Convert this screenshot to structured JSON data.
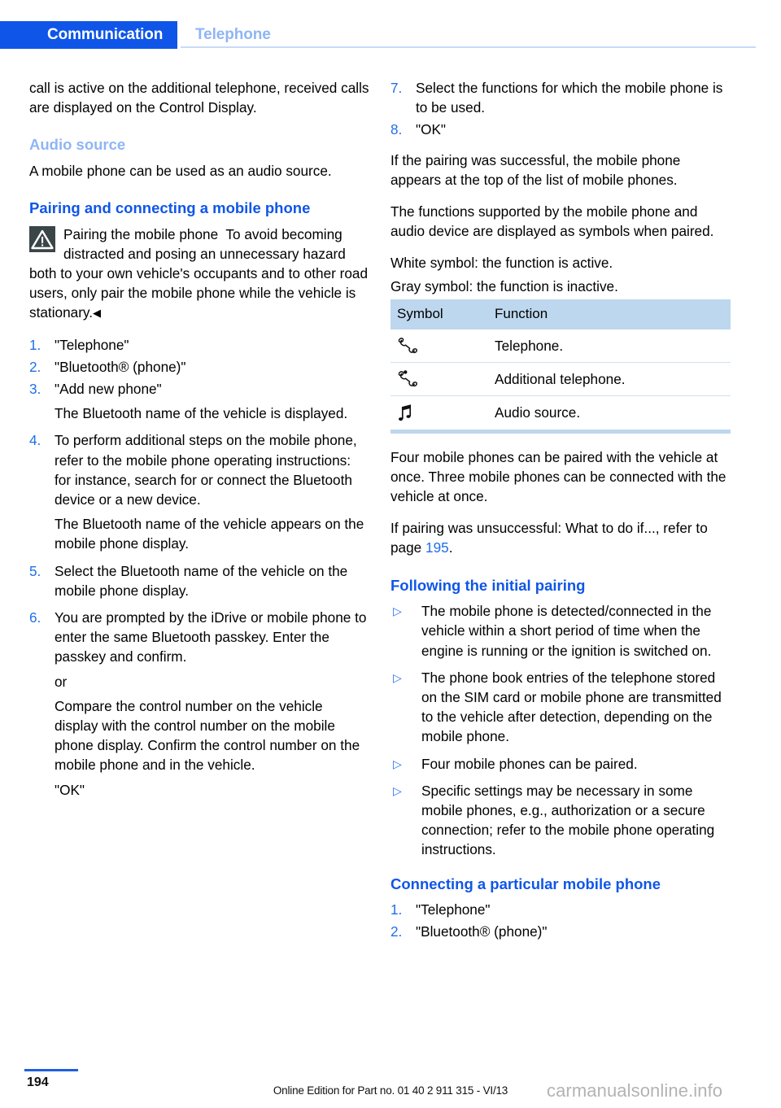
{
  "header": {
    "active_tab": "Communication",
    "inactive_tab": "Telephone",
    "active_bg": "#0f56e8",
    "inactive_color": "#8fb5f5"
  },
  "left_column": {
    "intro_paragraph": "call is active on the additional telephone, received calls are displayed on the Control Display.",
    "audio_source_heading": "Audio source",
    "audio_source_text": "A mobile phone can be used as an audio source.",
    "pairing_heading": "Pairing and connecting a mobile phone",
    "warning": {
      "icon": "warning-triangle-icon",
      "title": "Pairing the mobile phone",
      "text": "To avoid becoming distracted and posing an unnecessary hazard both to your own vehicle's occupants and to other road users, only pair the mobile phone while the vehicle is stationary.",
      "end_mark": "◀"
    },
    "steps": [
      {
        "num": "1.",
        "text": "\"Telephone\""
      },
      {
        "num": "2.",
        "text": "\"Bluetooth® (phone)\""
      },
      {
        "num": "3.",
        "text": "\"Add new phone\"",
        "sub": "The Bluetooth name of the vehicle is displayed."
      },
      {
        "num": "4.",
        "text": "To perform additional steps on the mobile phone, refer to the mobile phone operating instructions: for instance, search for or connect the Bluetooth device or a new device.",
        "sub": "The Bluetooth name of the vehicle appears on the mobile phone display."
      },
      {
        "num": "5.",
        "text": "Select the Bluetooth name of the vehicle on the mobile phone display."
      },
      {
        "num": "6.",
        "text": "You are prompted by the iDrive or mobile phone to enter the same Bluetooth passkey. Enter the passkey and confirm.",
        "sub": "or",
        "sub2": "Compare the control number on the vehicle display with the control number on the mobile phone display. Confirm the control number on the mobile phone and in the vehicle.",
        "sub3": "\"OK\""
      }
    ]
  },
  "right_column": {
    "steps": [
      {
        "num": "7.",
        "text": "Select the functions for which the mobile phone is to be used."
      },
      {
        "num": "8.",
        "text": "\"OK\""
      }
    ],
    "paragraph_1": "If the pairing was successful, the mobile phone appears at the top of the list of mobile phones.",
    "paragraph_2": "The functions supported by the mobile phone and audio device are displayed as symbols when paired.",
    "paragraph_3": "White symbol: the function is active.",
    "paragraph_4": "Gray symbol: the function is inactive.",
    "table": {
      "headers": [
        "Symbol",
        "Function"
      ],
      "header_bg": "#bdd7ee",
      "rows": [
        {
          "icon": "telephone-handset-icon",
          "function": "Telephone."
        },
        {
          "icon": "additional-telephone-handset-icon",
          "function": "Additional telephone."
        },
        {
          "icon": "music-note-icon",
          "function": "Audio source."
        }
      ]
    },
    "paragraph_5": "Four mobile phones can be paired with the vehicle at once. Three mobile phones can be connected with the vehicle at once.",
    "paragraph_6_part1": "If pairing was unsuccessful: What to do if..., refer to page ",
    "paragraph_6_page_ref": "195",
    "paragraph_6_part2": ".",
    "following_heading": "Following the initial pairing",
    "bullets": [
      {
        "marker": "▷",
        "text": "The mobile phone is detected/connected in the vehicle within a short period of time when the engine is running or the ignition is switched on."
      },
      {
        "marker": "▷",
        "text": "The phone book entries of the telephone stored on the SIM card or mobile phone are transmitted to the vehicle after detection, depending on the mobile phone."
      },
      {
        "marker": "▷",
        "text": "Four mobile phones can be paired."
      },
      {
        "marker": "▷",
        "text": "Specific settings may be necessary in some mobile phones, e.g., authorization or a secure connection; refer to the mobile phone operating instructions."
      }
    ],
    "connecting_heading": "Connecting a particular mobile phone",
    "connecting_steps": [
      {
        "num": "1.",
        "text": "\"Telephone\""
      },
      {
        "num": "2.",
        "text": "\"Bluetooth® (phone)\""
      }
    ]
  },
  "footer": {
    "page_number": "194",
    "edition_text": "Online Edition for Part no. 01 40 2 911 315 - VI/13",
    "watermark": "carmanualsonline.info"
  }
}
